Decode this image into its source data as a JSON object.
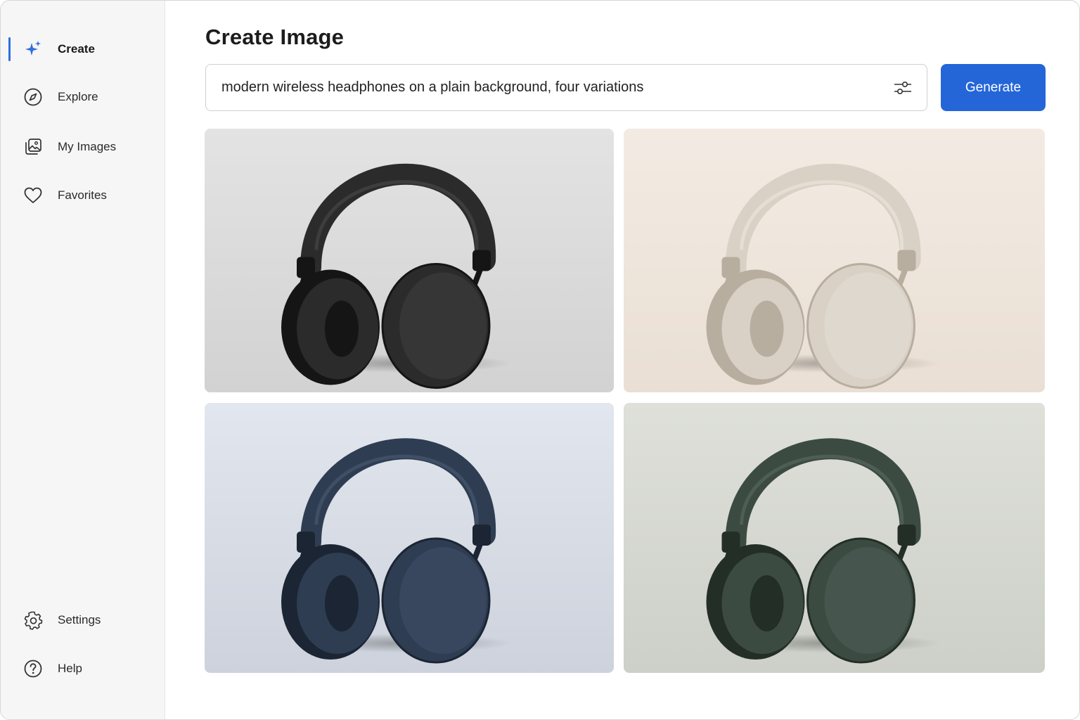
{
  "sidebar": {
    "items": [
      {
        "label": "Create",
        "icon": "sparkle-icon",
        "active": true
      },
      {
        "label": "Explore",
        "icon": "compass-icon"
      },
      {
        "label": "My Images",
        "icon": "image-gallery-icon"
      },
      {
        "label": "Favorites",
        "icon": "heart-icon"
      }
    ],
    "bottom": [
      {
        "label": "Settings",
        "icon": "gear-icon"
      },
      {
        "label": "Help",
        "icon": "help-icon"
      }
    ]
  },
  "main": {
    "title": "Create Image",
    "prompt": {
      "value": "modern wireless headphones on a plain background, four variations",
      "filter_icon": "sliders-icon"
    },
    "generate_label": "Generate"
  },
  "results": [
    {
      "variant": "black",
      "bg_top": "#e3e3e3",
      "bg_bottom": "#d2d2d2",
      "body": "#2b2b2b",
      "shade": "#151515",
      "highlight": "#4a4a4a"
    },
    {
      "variant": "beige",
      "bg_top": "#f3ebe3",
      "bg_bottom": "#e9dfd4",
      "body": "#d9d1c6",
      "shade": "#b8ae9f",
      "highlight": "#ece6dc"
    },
    {
      "variant": "navy",
      "bg_top": "#e2e6ee",
      "bg_bottom": "#cdd2dc",
      "body": "#2f3d52",
      "shade": "#1b2534",
      "highlight": "#4a5b74"
    },
    {
      "variant": "green",
      "bg_top": "#dee0d9",
      "bg_bottom": "#cdd0c8",
      "body": "#3c4b42",
      "shade": "#232e27",
      "highlight": "#5a6b60"
    }
  ],
  "colors": {
    "accent": "#2466d8",
    "sidebar_bg": "#f6f6f6",
    "sparkle": "#2f6fe0"
  }
}
